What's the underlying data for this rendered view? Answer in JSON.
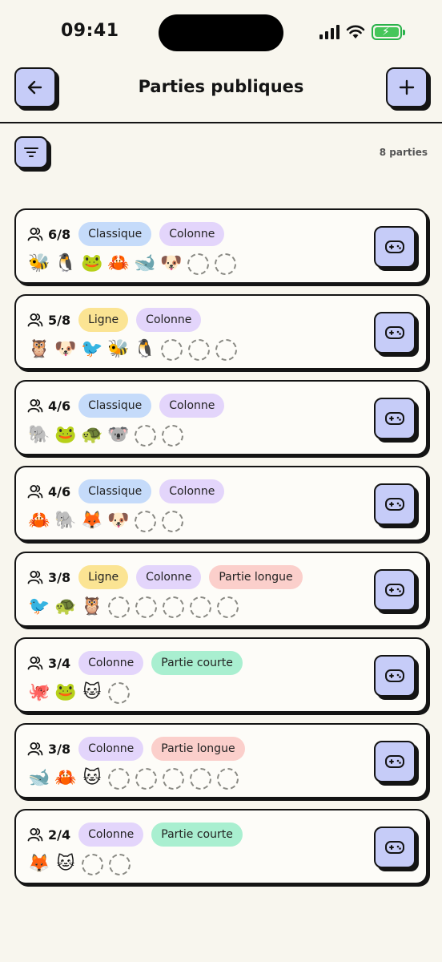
{
  "status": {
    "time": "09:41"
  },
  "header": {
    "title": "Parties publiques"
  },
  "toolbar": {
    "count_label": "8 parties"
  },
  "colors": {
    "accent": "#c6ccf8",
    "tag_classique": "#c5dbfa",
    "tag_ligne": "#fbe493",
    "tag_colonne": "#e3d5fb",
    "tag_longue": "#fbcfcb",
    "tag_courte": "#a9efd0"
  },
  "games": [
    {
      "players": "6/8",
      "tags": [
        {
          "label": "Classique",
          "color": "#c5dbfa"
        },
        {
          "label": "Colonne",
          "color": "#e3d5fb"
        }
      ],
      "animals": [
        "🐝",
        "🐧",
        "🐸",
        "🦀",
        "🐋",
        "🐶"
      ],
      "empty_slots": 2
    },
    {
      "players": "5/8",
      "tags": [
        {
          "label": "Ligne",
          "color": "#fbe493"
        },
        {
          "label": "Colonne",
          "color": "#e3d5fb"
        }
      ],
      "animals": [
        "🦉",
        "🐶",
        "🐦",
        "🐝",
        "🐧"
      ],
      "empty_slots": 3
    },
    {
      "players": "4/6",
      "tags": [
        {
          "label": "Classique",
          "color": "#c5dbfa"
        },
        {
          "label": "Colonne",
          "color": "#e3d5fb"
        }
      ],
      "animals": [
        "🐘",
        "🐸",
        "🐢",
        "🐨"
      ],
      "empty_slots": 2
    },
    {
      "players": "4/6",
      "tags": [
        {
          "label": "Classique",
          "color": "#c5dbfa"
        },
        {
          "label": "Colonne",
          "color": "#e3d5fb"
        }
      ],
      "animals": [
        "🦀",
        "🐘",
        "🦊",
        "🐶"
      ],
      "empty_slots": 2
    },
    {
      "players": "3/8",
      "tags": [
        {
          "label": "Ligne",
          "color": "#fbe493"
        },
        {
          "label": "Colonne",
          "color": "#e3d5fb"
        },
        {
          "label": "Partie longue",
          "color": "#fbcfcb"
        }
      ],
      "animals": [
        "🐦",
        "🐢",
        "🦉"
      ],
      "empty_slots": 5
    },
    {
      "players": "3/4",
      "tags": [
        {
          "label": "Colonne",
          "color": "#e3d5fb"
        },
        {
          "label": "Partie courte",
          "color": "#a9efd0"
        }
      ],
      "animals": [
        "🐙",
        "🐸",
        "🐱"
      ],
      "empty_slots": 1
    },
    {
      "players": "3/8",
      "tags": [
        {
          "label": "Colonne",
          "color": "#e3d5fb"
        },
        {
          "label": "Partie longue",
          "color": "#fbcfcb"
        }
      ],
      "animals": [
        "🐋",
        "🦀",
        "🐱"
      ],
      "empty_slots": 5
    },
    {
      "players": "2/4",
      "tags": [
        {
          "label": "Colonne",
          "color": "#e3d5fb"
        },
        {
          "label": "Partie courte",
          "color": "#a9efd0"
        }
      ],
      "animals": [
        "🦊",
        "🐱"
      ],
      "empty_slots": 2
    }
  ]
}
